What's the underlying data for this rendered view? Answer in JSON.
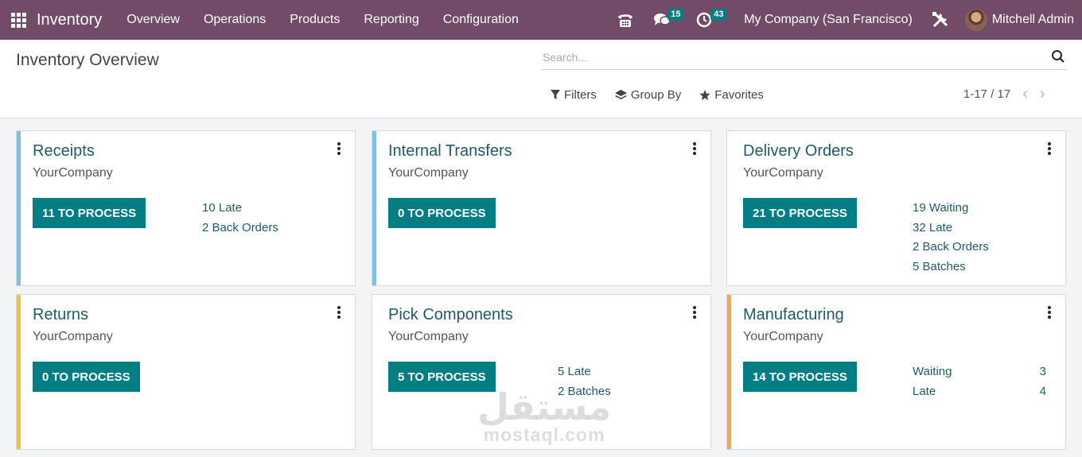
{
  "navbar": {
    "app_name": "Inventory",
    "menu": [
      "Overview",
      "Operations",
      "Products",
      "Reporting",
      "Configuration"
    ],
    "messages_count": "15",
    "activities_count": "43",
    "company": "My Company (San Francisco)",
    "user": "Mitchell Admin"
  },
  "control_panel": {
    "title": "Inventory Overview",
    "search_placeholder": "Search...",
    "filters_label": "Filters",
    "group_by_label": "Group By",
    "favorites_label": "Favorites",
    "pager": "1-17 / 17"
  },
  "colors": {
    "navbar": "#714b67",
    "primary_button": "#017e84",
    "accent_blue": "#7ec0e6",
    "accent_yellow": "#e9c83a",
    "accent_orange": "#e5a96a"
  },
  "cards": [
    {
      "title": "Receipts",
      "company": "YourCompany",
      "button": "11 TO PROCESS",
      "accent": "#7ec0e6",
      "stats": [
        "10 Late",
        "2 Back Orders"
      ]
    },
    {
      "title": "Internal Transfers",
      "company": "YourCompany",
      "button": "0 TO PROCESS",
      "accent": "#7ec0e6",
      "stats": []
    },
    {
      "title": "Delivery Orders",
      "company": "YourCompany",
      "button": "21 TO PROCESS",
      "accent": "",
      "stats": [
        "19 Waiting",
        "32 Late",
        "2 Back Orders",
        "5 Batches"
      ]
    },
    {
      "title": "Returns",
      "company": "YourCompany",
      "button": "0 TO PROCESS",
      "accent": "#e9c83a",
      "stats": []
    },
    {
      "title": "Pick Components",
      "company": "YourCompany",
      "button": "5 TO PROCESS",
      "accent": "",
      "stats": [
        "5 Late",
        "2 Batches"
      ]
    },
    {
      "title": "Manufacturing",
      "company": "YourCompany",
      "button": "14 TO PROCESS",
      "accent": "#e5a96a",
      "stat_pairs": [
        [
          "Waiting",
          "3"
        ],
        [
          "Late",
          "4"
        ]
      ]
    }
  ],
  "watermark": {
    "arabic": "مستقل",
    "latin": "mostaql.com"
  }
}
